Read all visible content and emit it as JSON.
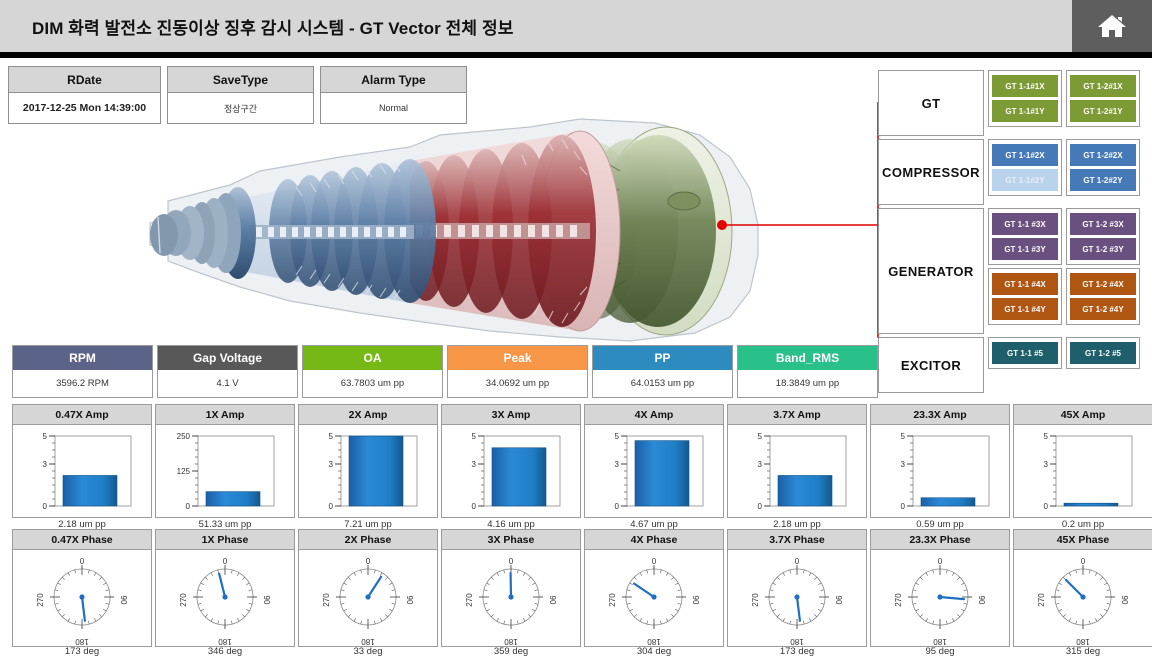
{
  "header": {
    "title": "DIM  화력 발전소 진동이상 징후 감시 시스템 - GT Vector 전체 정보",
    "home_icon": "home-icon"
  },
  "info_table": {
    "columns": [
      {
        "header": "RDate",
        "value": "2017-12-25 Mon 14:39:00",
        "emphasis": true
      },
      {
        "header": "SaveType",
        "value": "정상구간",
        "emphasis": false
      },
      {
        "header": "Alarm Type",
        "value": "Normal",
        "emphasis": false
      }
    ]
  },
  "tree": {
    "groups": [
      {
        "name": "GT",
        "height": 66,
        "tag_boxes": [
          {
            "tags": [
              {
                "label": "GT 1-1#1X",
                "color": "#7d9b34",
                "dim": false
              },
              {
                "label": "GT 1-1#1Y",
                "color": "#7d9b34",
                "dim": false
              }
            ]
          },
          {
            "tags": [
              {
                "label": "GT 1-2#1X",
                "color": "#7d9b34",
                "dim": false
              },
              {
                "label": "GT 1-2#1Y",
                "color": "#7d9b34",
                "dim": false
              }
            ]
          }
        ]
      },
      {
        "name": "COMPRESSOR",
        "height": 66,
        "tag_boxes": [
          {
            "tags": [
              {
                "label": "GT 1-1#2X",
                "color": "#4679b8",
                "dim": false
              },
              {
                "label": "GT 1-1#2Y",
                "color": "#b9d3ec",
                "dim": true
              }
            ]
          },
          {
            "tags": [
              {
                "label": "GT 1-2#2X",
                "color": "#4679b8",
                "dim": false
              },
              {
                "label": "GT 1-2#2Y",
                "color": "#4679b8",
                "dim": false
              }
            ]
          }
        ]
      },
      {
        "name": "GENERATOR",
        "height": 126,
        "tag_boxes": [
          {
            "tags": [
              {
                "label": "GT 1-1 #3X",
                "color": "#69507f",
                "dim": false
              },
              {
                "label": "GT 1-1 #3Y",
                "color": "#69507f",
                "dim": false
              }
            ]
          },
          {
            "tags": [
              {
                "label": "GT 1-2 #3X",
                "color": "#69507f",
                "dim": false
              },
              {
                "label": "GT 1-2 #3Y",
                "color": "#69507f",
                "dim": false
              }
            ]
          },
          {
            "tags": [
              {
                "label": "GT 1-1 #4X",
                "color": "#b05613",
                "dim": false
              },
              {
                "label": "GT 1-1 #4Y",
                "color": "#b05613",
                "dim": false
              }
            ]
          },
          {
            "tags": [
              {
                "label": "GT 1-2 #4X",
                "color": "#b05613",
                "dim": false
              },
              {
                "label": "GT 1-2 #4Y",
                "color": "#b05613",
                "dim": false
              }
            ]
          }
        ]
      },
      {
        "name": "EXCITOR",
        "height": 56,
        "tag_boxes": [
          {
            "tags": [
              {
                "label": "GT 1-1 #5",
                "color": "#1e5f6b",
                "dim": false
              }
            ]
          },
          {
            "tags": [
              {
                "label": "GT 1-2 #5",
                "color": "#1e5f6b",
                "dim": false
              }
            ]
          }
        ]
      }
    ],
    "connector_color": "#e00000"
  },
  "metrics": [
    {
      "label": "RPM",
      "value": "3596.2 RPM",
      "color": "#5b6389"
    },
    {
      "label": "Gap Voltage",
      "value": "4.1 V",
      "color": "#585858"
    },
    {
      "label": "OA",
      "value": "63.7803 um pp",
      "color": "#76b916"
    },
    {
      "label": "Peak",
      "value": "34.0692 um pp",
      "color": "#f79646"
    },
    {
      "label": "PP",
      "value": "64.0153 um pp",
      "color": "#2e8bc0"
    },
    {
      "label": "Band_RMS",
      "value": "18.3849 um pp",
      "color": "#29c08a"
    }
  ],
  "chart_data": [
    {
      "type": "bar",
      "title": "0.47X Amp",
      "categories": [
        "0.47X"
      ],
      "values": [
        2.18
      ],
      "value_label": "2.18 um pp",
      "ylim": [
        0,
        5
      ],
      "yticks": [
        0,
        3,
        5
      ],
      "ylabel": "",
      "xlabel": "",
      "grid": false
    },
    {
      "type": "bar",
      "title": "1X Amp",
      "categories": [
        "1X"
      ],
      "values": [
        51.33
      ],
      "value_label": "51.33 um pp",
      "ylim": [
        0,
        250
      ],
      "yticks": [
        0,
        125,
        250
      ],
      "ylabel": "",
      "xlabel": "",
      "grid": false
    },
    {
      "type": "bar",
      "title": "2X Amp",
      "categories": [
        "2X"
      ],
      "values": [
        7.21
      ],
      "value_label": "7.21 um pp",
      "ylim": [
        0,
        5
      ],
      "yticks": [
        0,
        3,
        5
      ],
      "ylabel": "",
      "xlabel": "",
      "grid": false
    },
    {
      "type": "bar",
      "title": "3X Amp",
      "categories": [
        "3X"
      ],
      "values": [
        4.16
      ],
      "value_label": "4.16 um pp",
      "ylim": [
        0,
        5
      ],
      "yticks": [
        0,
        3,
        5
      ],
      "ylabel": "",
      "xlabel": "",
      "grid": false
    },
    {
      "type": "bar",
      "title": "4X Amp",
      "categories": [
        "4X"
      ],
      "values": [
        4.67
      ],
      "value_label": "4.67 um pp",
      "ylim": [
        0,
        5
      ],
      "yticks": [
        0,
        3,
        5
      ],
      "ylabel": "",
      "xlabel": "",
      "grid": false
    },
    {
      "type": "bar",
      "title": "3.7X Amp",
      "categories": [
        "3.7X"
      ],
      "values": [
        2.18
      ],
      "value_label": "2.18 um pp",
      "ylim": [
        0,
        5
      ],
      "yticks": [
        0,
        3,
        5
      ],
      "ylabel": "",
      "xlabel": "",
      "grid": false
    },
    {
      "type": "bar",
      "title": "23.3X Amp",
      "categories": [
        "23.3X"
      ],
      "values": [
        0.59
      ],
      "value_label": "0.59 um pp",
      "ylim": [
        0,
        5
      ],
      "yticks": [
        0,
        3,
        5
      ],
      "ylabel": "",
      "xlabel": "",
      "grid": false
    },
    {
      "type": "bar",
      "title": "45X Amp",
      "categories": [
        "45X"
      ],
      "values": [
        0.2
      ],
      "value_label": "0.2 um pp",
      "ylim": [
        0,
        5
      ],
      "yticks": [
        0,
        3,
        5
      ],
      "ylabel": "",
      "xlabel": "",
      "grid": false
    },
    {
      "type": "scatter",
      "subtype": "polar-dial",
      "title": "0.47X Phase",
      "angle_deg": 173,
      "value_label": "173 deg",
      "tick_labels": [
        "0",
        "90",
        "180",
        "270"
      ],
      "range_deg": [
        0,
        360
      ]
    },
    {
      "type": "scatter",
      "subtype": "polar-dial",
      "title": "1X Phase",
      "angle_deg": 346,
      "value_label": "346 deg",
      "tick_labels": [
        "0",
        "90",
        "180",
        "270"
      ],
      "range_deg": [
        0,
        360
      ]
    },
    {
      "type": "scatter",
      "subtype": "polar-dial",
      "title": "2X Phase",
      "angle_deg": 33,
      "value_label": "33 deg",
      "tick_labels": [
        "0",
        "90",
        "180",
        "270"
      ],
      "range_deg": [
        0,
        360
      ]
    },
    {
      "type": "scatter",
      "subtype": "polar-dial",
      "title": "3X Phase",
      "angle_deg": 359,
      "value_label": "359 deg",
      "tick_labels": [
        "0",
        "90",
        "180",
        "270"
      ],
      "range_deg": [
        0,
        360
      ]
    },
    {
      "type": "scatter",
      "subtype": "polar-dial",
      "title": "4X Phase",
      "angle_deg": 304,
      "value_label": "304 deg",
      "tick_labels": [
        "0",
        "90",
        "180",
        "270"
      ],
      "range_deg": [
        0,
        360
      ]
    },
    {
      "type": "scatter",
      "subtype": "polar-dial",
      "title": "3.7X Phase",
      "angle_deg": 173,
      "value_label": "173 deg",
      "tick_labels": [
        "0",
        "90",
        "180",
        "270"
      ],
      "range_deg": [
        0,
        360
      ]
    },
    {
      "type": "scatter",
      "subtype": "polar-dial",
      "title": "23.3X Phase",
      "angle_deg": 95,
      "value_label": "95 deg",
      "tick_labels": [
        "0",
        "90",
        "180",
        "270"
      ],
      "range_deg": [
        0,
        360
      ]
    },
    {
      "type": "scatter",
      "subtype": "polar-dial",
      "title": "45X Phase",
      "angle_deg": 315,
      "value_label": "315 deg",
      "tick_labels": [
        "0",
        "90",
        "180",
        "270"
      ],
      "range_deg": [
        0,
        360
      ]
    }
  ],
  "colors": {
    "bar_fill": "#1f7fd0",
    "dial_needle": "#1f6fc4",
    "header_bg": "#d6d6d6",
    "panel_header_bg": "#d6d6d6"
  }
}
